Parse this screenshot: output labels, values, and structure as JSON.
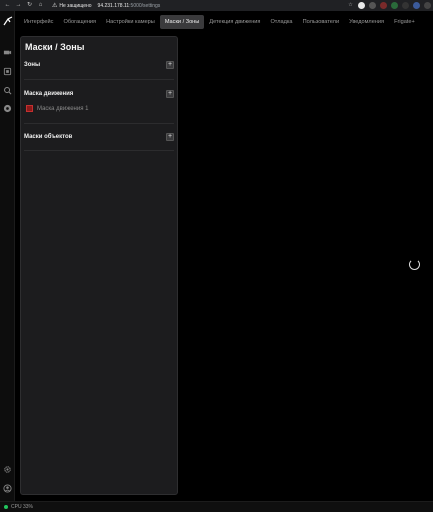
{
  "browser": {
    "back_icon": "arrow-left-icon",
    "security_label": "Не защищено",
    "url_host": "94.231.178.11",
    "url_path": ":5000/settings"
  },
  "tabs": [
    {
      "label": "Интерфейс",
      "active": false
    },
    {
      "label": "Обогащения",
      "active": false
    },
    {
      "label": "Настройки камеры",
      "active": false
    },
    {
      "label": "Маски / Зоны",
      "active": true
    },
    {
      "label": "Детекция движения",
      "active": false
    },
    {
      "label": "Отладка",
      "active": false
    },
    {
      "label": "Пользователи",
      "active": false
    },
    {
      "label": "Уведомления",
      "active": false
    },
    {
      "label": "Frigate+",
      "active": false
    }
  ],
  "panel": {
    "title": "Маски / Зоны",
    "zones_label": "Зоны",
    "motion_masks_label": "Маска движения",
    "motion_mask_item": "Маска движения 1",
    "object_masks_label": "Маски объектов",
    "add_symbol": "+"
  },
  "status": {
    "cpu": "CPU 33%"
  },
  "colors": {
    "accent": "#3a3a3c",
    "mask_color": "#8b1a1a",
    "status_ok": "#22c55e"
  }
}
